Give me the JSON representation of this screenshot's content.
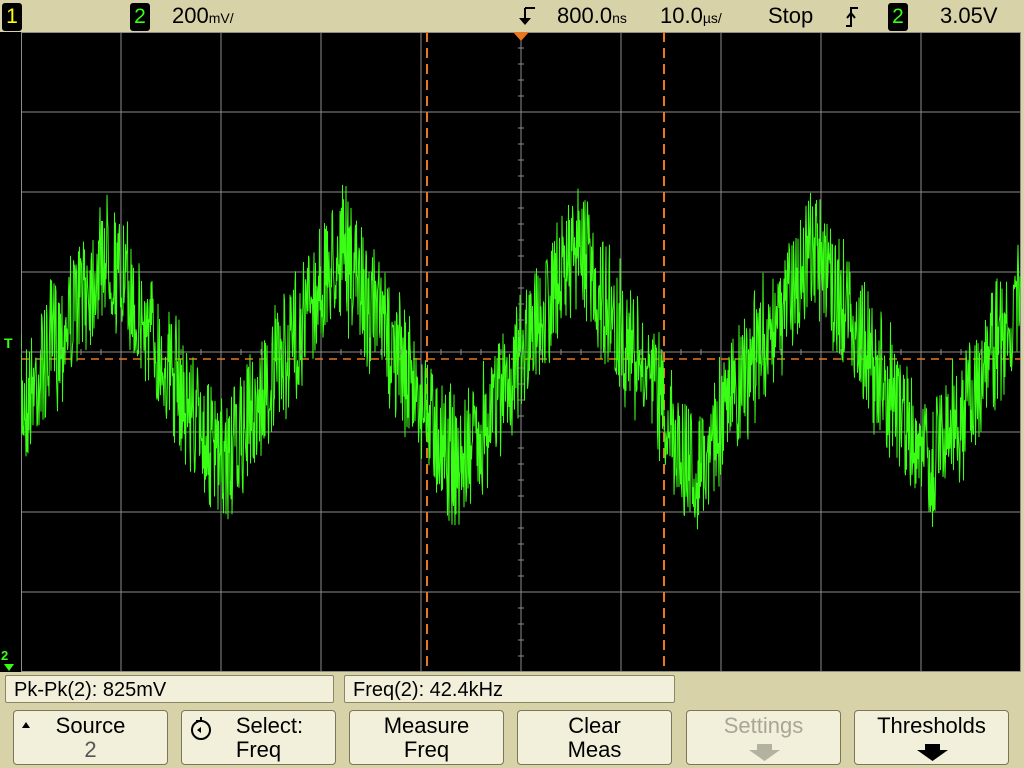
{
  "status": {
    "ch1_label": "1",
    "ch2_label": "2",
    "volts_per_div": "200",
    "volts_unit": "mV/",
    "trigger_delay": "800.0",
    "delay_unit": "ns",
    "time_per_div": "10.0",
    "time_unit": "µs/",
    "run_state": "Stop",
    "trigger_slope_icon": "rising-edge-icon",
    "trigger_source": "2",
    "trigger_level": "3.05V"
  },
  "screen": {
    "trigger_marker": "T",
    "ground_marker_num": "2",
    "ground_marker_label": "2",
    "colors": {
      "trace": "#39ff14",
      "grid": "#8c8c8c",
      "cursor": "#e8771f",
      "background": "#000000"
    }
  },
  "measurements": [
    {
      "label": "Pk-Pk(2): 825mV"
    },
    {
      "label": "Freq(2): 42.4kHz"
    }
  ],
  "softkeys": [
    {
      "line1": "Source",
      "line2": "2"
    },
    {
      "line1": "Select:",
      "line2": "Freq"
    },
    {
      "line1": "Measure",
      "line2": "Freq"
    },
    {
      "line1": "Clear",
      "line2": "Meas"
    },
    {
      "line1": "Settings",
      "line2": ""
    },
    {
      "line1": "Thresholds",
      "line2": ""
    }
  ]
}
